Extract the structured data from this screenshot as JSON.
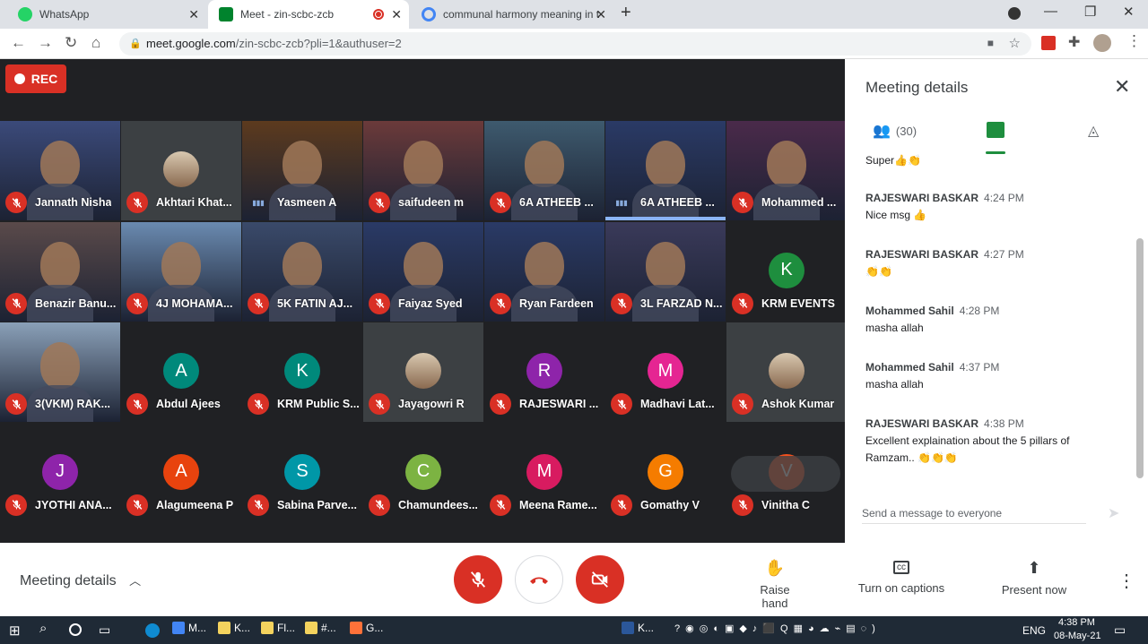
{
  "tabs": [
    {
      "title": "WhatsApp",
      "fav": "#25d366"
    },
    {
      "title": "Meet - zin-scbc-zcb",
      "fav": "#00832d",
      "recording": true
    },
    {
      "title": "communal harmony meaning in t",
      "fav": "#4285f4"
    }
  ],
  "address": {
    "host": "meet.google.com",
    "path": "/zin-scbc-zcb?pli=1&authuser=2"
  },
  "rec_label": "REC",
  "participants": [
    {
      "name": "Jannath Nisha",
      "kind": "video",
      "bg": "#3b4a7a"
    },
    {
      "name": "Akhtari Khat...",
      "kind": "photo",
      "bg": "#202124"
    },
    {
      "name": "Yasmeen A",
      "kind": "video",
      "bg": "#5c3a1e",
      "speaking": true
    },
    {
      "name": "saifudeen m",
      "kind": "video",
      "bg": "#6b3a3a"
    },
    {
      "name": "6A ATHEEB ...",
      "kind": "video",
      "bg": "#3e5a6e"
    },
    {
      "name": "6A ATHEEB ...",
      "kind": "video",
      "bg": "#2a3a66",
      "speaking": true
    },
    {
      "name": "Mohammed ...",
      "kind": "video",
      "bg": "#4a2a4a"
    },
    {
      "name": "Benazir Banu...",
      "kind": "video",
      "bg": "#5a4a4a"
    },
    {
      "name": "4J MOHAMA...",
      "kind": "video",
      "bg": "#6a8ab0"
    },
    {
      "name": "5K FATIN AJ...",
      "kind": "video",
      "bg": "#3a4a6a"
    },
    {
      "name": "Faiyaz Syed",
      "kind": "video",
      "bg": "#2a3a66"
    },
    {
      "name": "Ryan Fardeen",
      "kind": "video",
      "bg": "#2a3a66"
    },
    {
      "name": "3L FARZAD N...",
      "kind": "video",
      "bg": "#3a3a5a"
    },
    {
      "name": "KRM EVENTS",
      "kind": "avatar",
      "initial": "K",
      "color": "#1e8e3e"
    },
    {
      "name": "3(VKM) RAK...",
      "kind": "video",
      "bg": "#8aa0b8"
    },
    {
      "name": "Abdul Ajees",
      "kind": "avatar",
      "initial": "A",
      "color": "#00897b"
    },
    {
      "name": "KRM Public S...",
      "kind": "avatar",
      "initial": "K",
      "color": "#00897b"
    },
    {
      "name": "Jayagowri R",
      "kind": "photo"
    },
    {
      "name": "RAJESWARI ...",
      "kind": "avatar",
      "initial": "R",
      "color": "#8e24aa"
    },
    {
      "name": "Madhavi Lat...",
      "kind": "avatar",
      "initial": "M",
      "color": "#e52592"
    },
    {
      "name": "Ashok Kumar",
      "kind": "photo"
    },
    {
      "name": "JYOTHI ANA...",
      "kind": "avatar",
      "initial": "J",
      "color": "#8e24aa"
    },
    {
      "name": "Alagumeena P",
      "kind": "avatar",
      "initial": "A",
      "color": "#e8430e"
    },
    {
      "name": "Sabina Parve...",
      "kind": "avatar",
      "initial": "S",
      "color": "#0097a7"
    },
    {
      "name": "Chamundees...",
      "kind": "avatar",
      "initial": "C",
      "color": "#7cb342"
    },
    {
      "name": "Meena Rame...",
      "kind": "avatar",
      "initial": "M",
      "color": "#d81b60"
    },
    {
      "name": "Gomathy V",
      "kind": "avatar",
      "initial": "G",
      "color": "#f57c00"
    },
    {
      "name": "Vinitha C",
      "kind": "avatar",
      "initial": "V",
      "color": "#f4511e",
      "hover": true
    }
  ],
  "panel": {
    "title": "Meeting details",
    "people_count": "(30)",
    "messages": [
      {
        "text": "Super👍👏"
      },
      {
        "who": "RAJESWARI BASKAR",
        "time": "4:24 PM",
        "text": "Nice msg 👍"
      },
      {
        "who": "RAJESWARI BASKAR",
        "time": "4:27 PM",
        "text": "👏👏"
      },
      {
        "who": "Mohammed Sahil",
        "time": "4:28 PM",
        "text": "masha allah"
      },
      {
        "who": "Mohammed Sahil",
        "time": "4:37 PM",
        "text": "masha allah"
      },
      {
        "who": "RAJESWARI BASKAR",
        "time": "4:38 PM",
        "text": "Excellent explaination about the 5 pillars of Ramzam.. 👏👏👏"
      }
    ],
    "input_placeholder": "Send a message to everyone"
  },
  "bottom": {
    "meeting_details": "Meeting details",
    "raise_hand": "Raise hand",
    "captions": "Turn on captions",
    "present": "Present now"
  },
  "taskbar": {
    "apps": [
      "M...",
      "K...",
      "Fl...",
      "#...",
      "G...",
      "K..."
    ],
    "lang": "ENG",
    "time": "4:38 PM",
    "date": "08-May-21"
  }
}
